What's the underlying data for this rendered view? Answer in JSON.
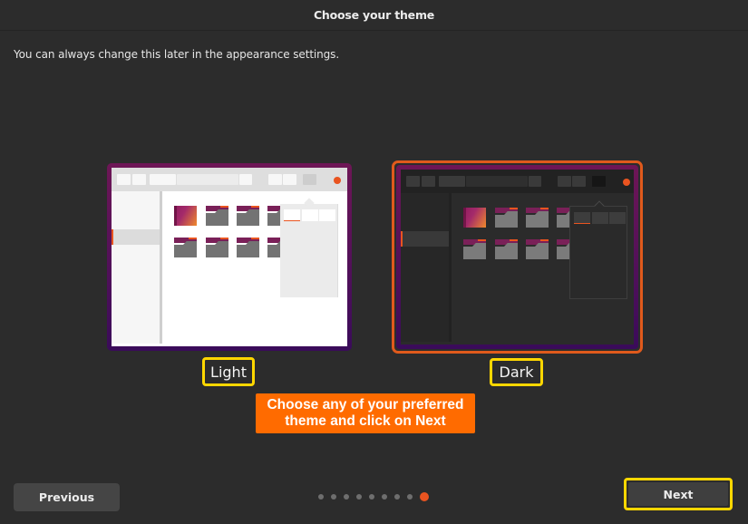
{
  "header": {
    "title": "Choose your theme"
  },
  "subtitle": "You can always change this later in the appearance settings.",
  "themes": [
    {
      "id": "light",
      "label": "Light",
      "selected": false
    },
    {
      "id": "dark",
      "label": "Dark",
      "selected": true
    }
  ],
  "annotation": {
    "text": "Choose any of your preferred theme and click on Next",
    "color": "#ff6b00"
  },
  "navigation": {
    "previous_label": "Previous",
    "next_label": "Next",
    "page_count": 9,
    "current_page": 9
  },
  "colors": {
    "accent": "#e95420",
    "highlight": "#ffd700",
    "background": "#2c2c2c"
  }
}
